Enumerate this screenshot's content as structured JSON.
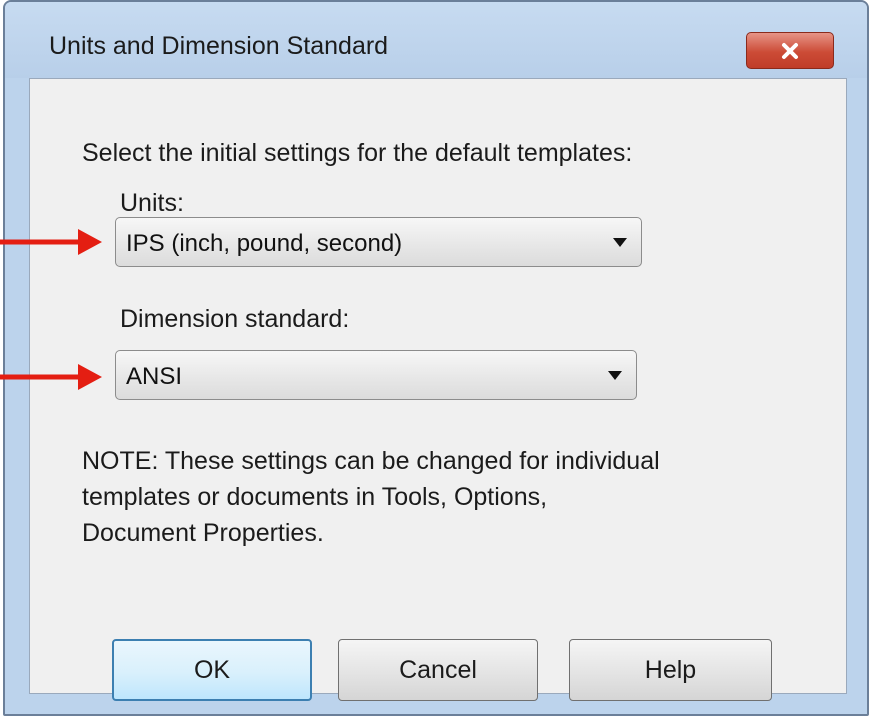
{
  "window": {
    "title": "Units and Dimension Standard"
  },
  "dialog": {
    "instruction": "Select the initial settings for the default templates:",
    "units": {
      "label": "Units:",
      "selected": "IPS (inch, pound, second)"
    },
    "dimension_standard": {
      "label": "Dimension standard:",
      "selected": "ANSI"
    },
    "note": "NOTE: These settings can be changed for individual\ntemplates or documents in Tools, Options,\nDocument Properties."
  },
  "buttons": {
    "ok": "OK",
    "cancel": "Cancel",
    "help": "Help"
  },
  "icons": {
    "close": "close-icon",
    "dropdown": "chevron-down-icon",
    "annotation": "arrow-right-icon"
  },
  "colors": {
    "annotation_arrow": "#e41e12",
    "close_button": "#cc4b36",
    "default_button_border": "#3c7fb1",
    "title_bar": "#bcd3ec"
  }
}
